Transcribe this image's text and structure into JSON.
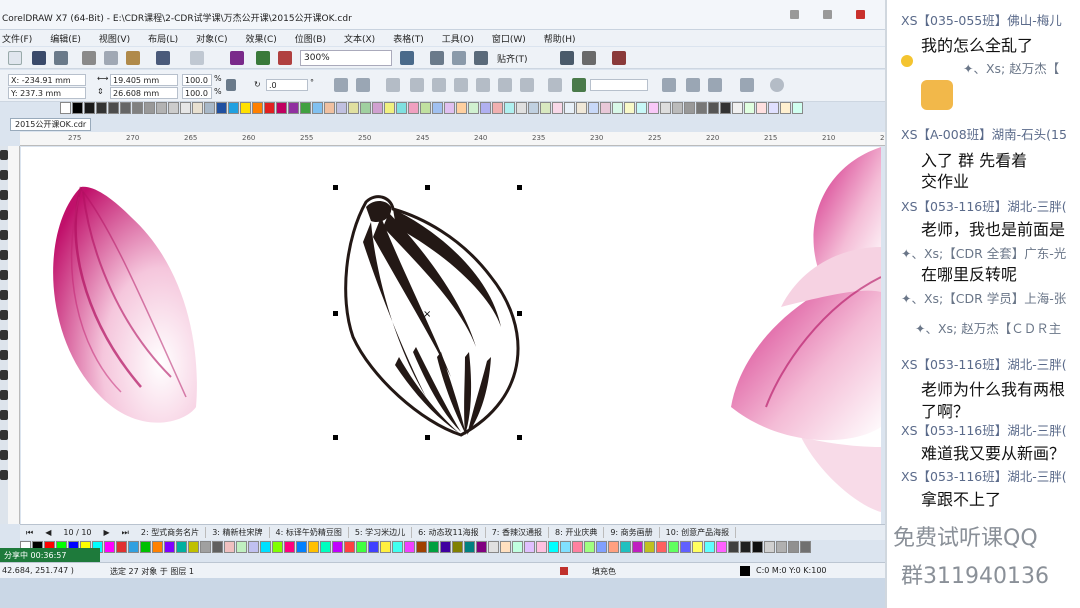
{
  "window": {
    "title": "CorelDRAW X7 (64-Bit) - E:\\CDR课程\\2-CDR试学课\\万杰公开课\\2015公开课OK.cdr"
  },
  "menu": [
    "文件(F)",
    "编辑(E)",
    "视图(V)",
    "布局(L)",
    "对象(C)",
    "效果(C)",
    "位图(B)",
    "文本(X)",
    "表格(T)",
    "工具(O)",
    "窗口(W)",
    "帮助(H)"
  ],
  "toolbar": {
    "zoom": "300%",
    "snap_label": "贴齐(T)"
  },
  "properties": {
    "x": "X: -234.91 mm",
    "y": "Y: 237.3 mm",
    "width": "19.405 mm",
    "height": "26.608 mm",
    "scale_x": "100.0",
    "scale_y": "100.0",
    "pct": "%",
    "rotation": ".0",
    "deg": "°"
  },
  "document_tab": "2015公开课OK.cdr",
  "ruler_ticks": [
    "275",
    "270",
    "265",
    "260",
    "255",
    "250",
    "245",
    "240",
    "235",
    "230",
    "225",
    "220",
    "215",
    "210",
    "205"
  ],
  "pages": {
    "counter": "10 / 10",
    "tabs": [
      "2: 型式商务名片",
      "3: 精新柱宋牌",
      "4: 标译午奶精豆图",
      "5: 学习米边儿",
      "6: 动态玫11海报",
      "7: 香辣汉通报",
      "8: 开业庆典",
      "9: 商务画册",
      "10: 创意产品海报"
    ]
  },
  "status": {
    "recording": "分享中 00:36:57",
    "cursor": "42.684, 251.747 )",
    "selection": "选定 27 对象 于 图层 1",
    "fill_label": "填充色",
    "color_info": "C:0 M:0 Y:0 K:100"
  },
  "colors": {
    "accent_title": "#c9302c",
    "petal": "#d0287c",
    "selected_shape": "#231815",
    "recording": "#1e7a3b"
  },
  "palette_top": [
    "#ffffff",
    "#000000",
    "#1a1a1a",
    "#333333",
    "#4d4d4d",
    "#666666",
    "#808080",
    "#999999",
    "#b3b3b3",
    "#cccccc",
    "#e6e6e6",
    "#e8e0d0",
    "#a8b8c8",
    "#2050a0",
    "#20a0e0",
    "#ffe000",
    "#ff8000",
    "#e02020",
    "#c00060",
    "#9030a0",
    "#40a040",
    "#80c0f0",
    "#f0c0a0",
    "#c0c0e0",
    "#e0e0a0",
    "#a0d0a0",
    "#d0a0d0",
    "#f0f080",
    "#80e0e0",
    "#f0a0c0",
    "#c0e0a0",
    "#a0c0f0",
    "#e0c0f0",
    "#ffd0a0",
    "#d0f0d0",
    "#b0b0f0",
    "#f0b0b0",
    "#b0f0f0",
    "#e0e0e0",
    "#c0d0e0",
    "#d8e8c0",
    "#f8d8e8",
    "#e8f0f8",
    "#f0e8d8",
    "#c8d8f8",
    "#e8c8d8",
    "#d8f8e8",
    "#f8f8c8",
    "#c8f8f8",
    "#f8c8f8",
    "#dddddd",
    "#bbbbbb",
    "#999999",
    "#777777",
    "#555555",
    "#333333",
    "#f0f0f0",
    "#e0ffe0",
    "#ffe0e0",
    "#e0e0ff",
    "#fff0d0",
    "#d0fff0"
  ],
  "palette_bottom": [
    "#ffffff",
    "#000000",
    "#ff0000",
    "#00ff00",
    "#0000ff",
    "#ffff00",
    "#00ffff",
    "#ff00ff",
    "#e03030",
    "#30a0e0",
    "#00c000",
    "#ff8000",
    "#8000ff",
    "#00b0a0",
    "#c0c000",
    "#a0a0a0",
    "#606060",
    "#f0c0c0",
    "#c0f0c0",
    "#c0c0f0",
    "#00e0ff",
    "#80ff00",
    "#ff0080",
    "#0080ff",
    "#ffc000",
    "#00ffc0",
    "#c000ff",
    "#ff4040",
    "#40ff40",
    "#4040ff",
    "#fff040",
    "#40fff0",
    "#f040ff",
    "#a04000",
    "#00a040",
    "#4000a0",
    "#808000",
    "#008080",
    "#800080",
    "#e0e0e0",
    "#ffe0c0",
    "#c0ffe0",
    "#e0c0ff",
    "#ffc0e0",
    "#00ffff",
    "#80e0ff",
    "#ff80a0",
    "#a0ff80",
    "#80a0ff",
    "#ffa080",
    "#20c0c0",
    "#c020c0",
    "#c0c020",
    "#ff6060",
    "#60ff60",
    "#6060ff",
    "#ffff60",
    "#60ffff",
    "#ff60ff",
    "#404040",
    "#202020",
    "#101010",
    "#d0d0d0",
    "#b0b0b0",
    "#909090",
    "#707070"
  ],
  "chat": {
    "messages": [
      {
        "kind": "hdr",
        "text": "XS【035-055班】佛山-梅儿"
      },
      {
        "kind": "body",
        "text": "我的怎么全乱了"
      },
      {
        "kind": "sys",
        "text": "✦、Xs;  赵万杰【"
      },
      {
        "kind": "hdr",
        "text": "XS【A-008班】湖南-石头(15"
      },
      {
        "kind": "body",
        "text": "入了 群       先看着"
      },
      {
        "kind": "body",
        "text": "交作业"
      },
      {
        "kind": "hdr",
        "text": "XS【053-116班】湖北-三胖("
      },
      {
        "kind": "body",
        "text": "老师，我也是前面是"
      },
      {
        "kind": "sys",
        "text": "✦、Xs;【CDR 全套】广东-光"
      },
      {
        "kind": "body",
        "text": "在哪里反转呢"
      },
      {
        "kind": "sys",
        "text": "✦、Xs;【CDR 学员】上海-张"
      },
      {
        "kind": "sys",
        "text": "✦、Xs;  赵万杰【ＣＤＲ主"
      },
      {
        "kind": "hdr",
        "text": "XS【053-116班】湖北-三胖("
      },
      {
        "kind": "body",
        "text": "老师为什么我有两根"
      },
      {
        "kind": "body",
        "text": "了啊？"
      },
      {
        "kind": "hdr",
        "text": "XS【053-116班】湖北-三胖("
      },
      {
        "kind": "body",
        "text": "难道我又要从新画？"
      },
      {
        "kind": "hdr",
        "text": "XS【053-116班】湖北-三胖("
      },
      {
        "kind": "body",
        "text": "拿跟不上了"
      }
    ],
    "promo_1": "免费试听课QQ",
    "promo_2": "群311940136"
  }
}
